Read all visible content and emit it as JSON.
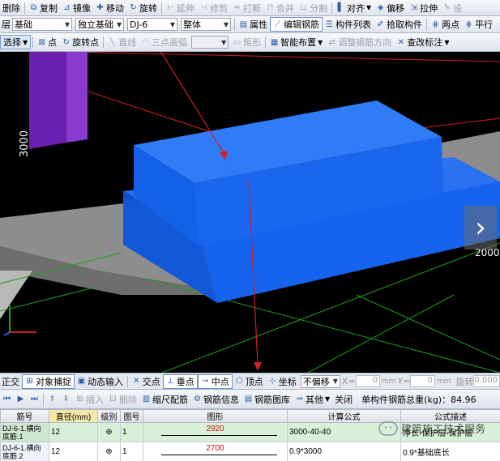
{
  "toolbar1": {
    "delete": "删除",
    "copy": "复制",
    "mirror": "镜像",
    "move": "移动",
    "rotate": "旋转",
    "extend": "延伸",
    "trim": "修剪",
    "break": "打断",
    "merge": "合并",
    "split": "分割",
    "align": "对齐",
    "offset": "偏移",
    "pull": "拉伸",
    "settings": "设"
  },
  "toolbar2": {
    "layer_label": "层",
    "layer_value": "基础",
    "type_value": "独立基础",
    "element_value": "DJ-6",
    "part_value": "整体",
    "properties": "属性",
    "edit_rebar": "编辑钢筋",
    "component_list": "构件列表",
    "pick_component": "拾取构件",
    "two_points": "两点",
    "parallel": "平行"
  },
  "toolbar3": {
    "select": "选择",
    "point": "点",
    "rotate_point": "旋转点",
    "line": "直线",
    "arc": "三点画弧",
    "rect": "矩形",
    "smart_layout": "智能布置",
    "adjust_rebar_dir": "调整钢筋方向",
    "check_label": "查改标注"
  },
  "viewport": {
    "dim_left": "3000",
    "dim_right": "2000",
    "colors": {
      "footing": "#1560e8",
      "footing_top": "#2a72f2",
      "column": "#6a1fb0",
      "slab": "#9c9c9c",
      "grid_red": "#d02020",
      "grid_green": "#1ea01e"
    }
  },
  "snapbar": {
    "ortho": "正交",
    "object_snap": "对象捕捉",
    "dynamic_input": "动态输入",
    "intersection": "交点",
    "perpendicular": "垂点",
    "midpoint": "中点",
    "vertex": "顶点",
    "coordinate": "坐标",
    "offset_mode": "不偏移",
    "x_label": "X=",
    "x_value": "0",
    "x_unit": "mm",
    "y_label": "Y=",
    "y_value": "0",
    "y_unit": "mm",
    "rotate_label": "旋转",
    "rotate_value": "0.000"
  },
  "rebarbar": {
    "insert": "插入",
    "delete": "删除",
    "scale_rebar": "缩尺配筋",
    "rebar_info": "钢筋信息",
    "rebar_library": "钢筋图库",
    "other": "其他",
    "close": "关闭",
    "total_weight": "单构件钢筋总重(kg)：84.96"
  },
  "table": {
    "headers": [
      "筋号",
      "直径(mm)",
      "级别",
      "图号",
      "图形",
      "计算公式",
      "公式描述"
    ],
    "rows": [
      {
        "id": "DJ-6-1.横向底筋.1",
        "diameter": "12",
        "grade": "⊕",
        "fig": "1",
        "shape_len": "2920",
        "formula": "3000-40-40",
        "desc": "净长-保护层-保护层"
      },
      {
        "id": "DJ-6-1.横向底筋.2",
        "diameter": "12",
        "grade": "⊕",
        "fig": "1",
        "shape_len": "2700",
        "formula": "0.9*3000",
        "desc": "0.9*基础底长"
      }
    ]
  },
  "watermark": "建筑施工技术服务"
}
